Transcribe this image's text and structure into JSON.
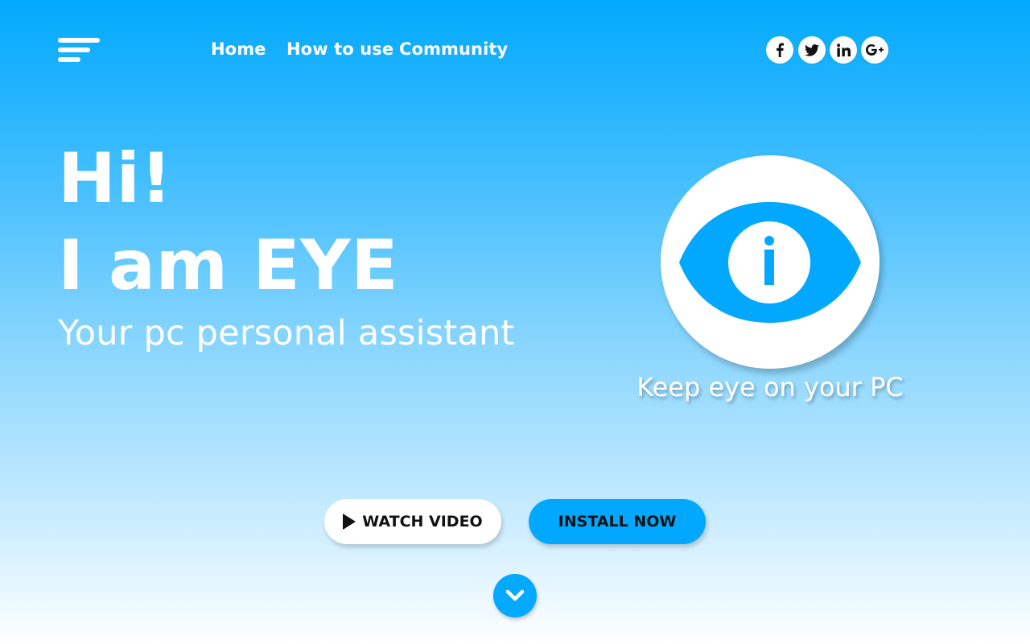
{
  "nav": {
    "links": [
      "Home",
      "How to use",
      "Community"
    ]
  },
  "social": {
    "icons": [
      "facebook-icon",
      "twitter-icon",
      "linkedin-icon",
      "google-plus-icon"
    ]
  },
  "hero": {
    "line1": "Hi!",
    "line2": "I am EYE",
    "subtitle": "Your pc personal assistant",
    "tagline": "Keep eye on your PC"
  },
  "buttons": {
    "watch_video": "WATCH VIDEO",
    "install_now": "INSTALL NOW"
  },
  "colors": {
    "accent": "#01a8fd",
    "background_top": "#02a9fd",
    "background_bottom": "#ffffff"
  }
}
